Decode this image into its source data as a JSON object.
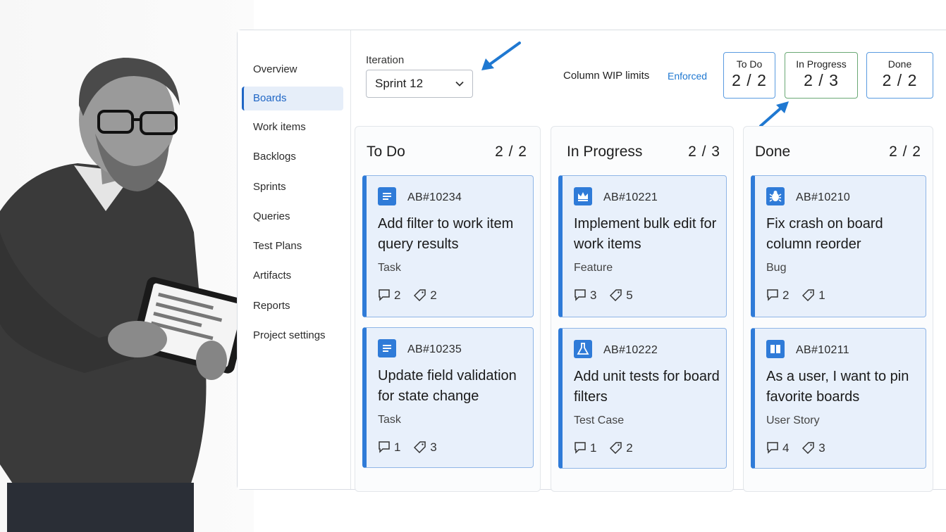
{
  "sidebar": {
    "items": [
      {
        "label": "Overview",
        "active": false
      },
      {
        "label": "Boards",
        "active": true
      },
      {
        "label": "Work items",
        "active": false
      },
      {
        "label": "Backlogs",
        "active": false
      },
      {
        "label": "Sprints",
        "active": false
      },
      {
        "label": "Queries",
        "active": false
      },
      {
        "label": "Test Plans",
        "active": false
      },
      {
        "label": "Artifacts",
        "active": false
      },
      {
        "label": "Reports",
        "active": false
      },
      {
        "label": "Project settings",
        "active": false
      }
    ]
  },
  "toolbar": {
    "iteration_label": "Iteration",
    "iteration_value": "Sprint 12",
    "wip_label": "Column WIP limits",
    "wip_status": "Enforced",
    "wip_boxes": [
      {
        "title": "To Do",
        "value": "2 / 2"
      },
      {
        "title": "In Progress",
        "value": "2 / 3"
      },
      {
        "title": "Done",
        "value": "2 / 2"
      }
    ]
  },
  "columns": [
    {
      "title": "To Do",
      "count": "2 / 2",
      "cards": [
        {
          "id": "AB#10234",
          "title": "Add filter to work item query results",
          "type": "Task",
          "icon": "task-icon",
          "comments": "2",
          "tags": "2"
        },
        {
          "id": "AB#10235",
          "title": "Update field validation for state change",
          "type": "Task",
          "icon": "task-icon",
          "comments": "1",
          "tags": "3"
        }
      ]
    },
    {
      "title": "In Progress",
      "count": "2 / 3",
      "cards": [
        {
          "id": "AB#10221",
          "title": "Implement bulk edit for work items",
          "type": "Feature",
          "icon": "crown-icon",
          "comments": "3",
          "tags": "5"
        },
        {
          "id": "AB#10222",
          "title": "Add unit tests for board filters",
          "type": "Test Case",
          "icon": "flask-icon",
          "comments": "1",
          "tags": "2"
        }
      ]
    },
    {
      "title": "Done",
      "count": "2 / 2",
      "cards": [
        {
          "id": "AB#10210",
          "title": "Fix crash on board column reorder",
          "type": "Bug",
          "icon": "bug-icon",
          "comments": "2",
          "tags": "1"
        },
        {
          "id": "AB#10211",
          "title": "As a user, I want to pin favorite boards",
          "type": "User Story",
          "icon": "book-icon",
          "comments": "4",
          "tags": "3"
        }
      ]
    }
  ],
  "colors": {
    "accent": "#2f7bd8",
    "card_bg": "#e8f0fb",
    "wip_green": "#6aa874",
    "arrow": "#1f78d1"
  }
}
